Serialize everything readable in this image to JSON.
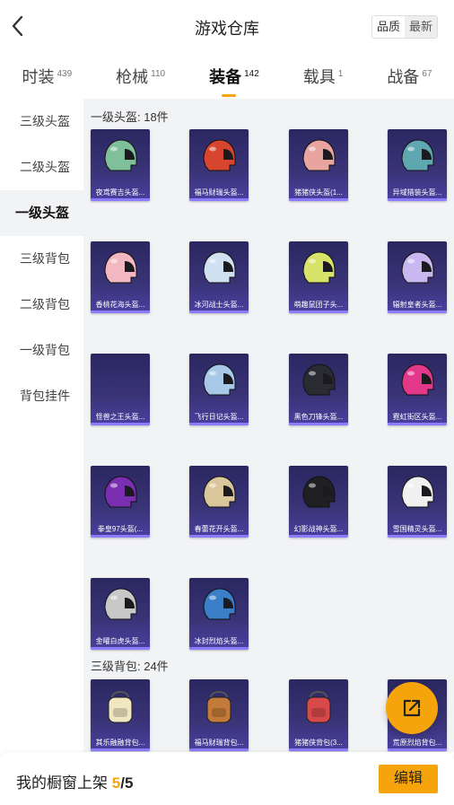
{
  "header": {
    "title": "游戏仓库",
    "sort_quality": "品质",
    "sort_newest": "最新"
  },
  "tabs": [
    {
      "label": "时装",
      "count": "439"
    },
    {
      "label": "枪械",
      "count": "110"
    },
    {
      "label": "装备",
      "count": "142"
    },
    {
      "label": "载具",
      "count": "1"
    },
    {
      "label": "战备",
      "count": "67"
    }
  ],
  "sidebar": {
    "items": [
      "三级头盔",
      "二级头盔",
      "一级头盔",
      "三级背包",
      "二级背包",
      "一级背包",
      "背包挂件"
    ]
  },
  "sections": [
    {
      "title": "一级头盔: 18件",
      "items": [
        {
          "label": "夜鸢赛吉头盔...",
          "color": "#7fbf9a"
        },
        {
          "label": "福马财瑞头盔...",
          "color": "#d8452f"
        },
        {
          "label": "猪猪侠头盔(1...",
          "color": "#e8a5a0"
        },
        {
          "label": "异域猎装头盔...",
          "color": "#5fa7b0"
        },
        {
          "label": "香桃花海头盔...",
          "color": "#f2b7c1"
        },
        {
          "label": "冰河战士头盔...",
          "color": "#cfe0f0"
        },
        {
          "label": "萌趣鼠团子头...",
          "color": "#d8e36a"
        },
        {
          "label": "辐射皇者头盔...",
          "color": "#c9b8f0"
        },
        {
          "label": "怪兽之王头盔...",
          "color": ""
        },
        {
          "label": "飞行日记头盔...",
          "color": "#a8c8e8"
        },
        {
          "label": "黑色刀锋头盔...",
          "color": "#2a2a33"
        },
        {
          "label": "霓虹街区头盔...",
          "color": "#e2388a"
        },
        {
          "label": "拳皇97头盔(...",
          "color": "#7a2fb0"
        },
        {
          "label": "春蕾花开头盔...",
          "color": "#d9c69a"
        },
        {
          "label": "幻影战神头盔...",
          "color": "#1f1f24"
        },
        {
          "label": "雪国精灵头盔...",
          "color": "#f0f0f0"
        },
        {
          "label": "金曜白虎头盔...",
          "color": "#c8c8c8"
        },
        {
          "label": "冰封烈焰头盔...",
          "color": "#3a7fc8"
        }
      ]
    },
    {
      "title": "三级背包: 24件",
      "items": [
        {
          "label": "其乐融融背包...",
          "color": "#f0e6c0"
        },
        {
          "label": "福马财瑞背包...",
          "color": "#c47a3a"
        },
        {
          "label": "猪猪侠背包(3...",
          "color": "#d84a4a"
        },
        {
          "label": "荒原烈焰背包...",
          "color": "#c88a3a"
        }
      ]
    }
  ],
  "footer": {
    "text": "我的橱窗上架",
    "current": "5",
    "separator": "/",
    "total": "5",
    "edit_label": "编辑"
  },
  "colors": {
    "accent": "#f5a50b",
    "card_bg": "#2f2b6a",
    "card_edge": "#8b7cff"
  },
  "icons": {
    "back": "chevron-left-icon",
    "fab": "share-external-icon"
  }
}
